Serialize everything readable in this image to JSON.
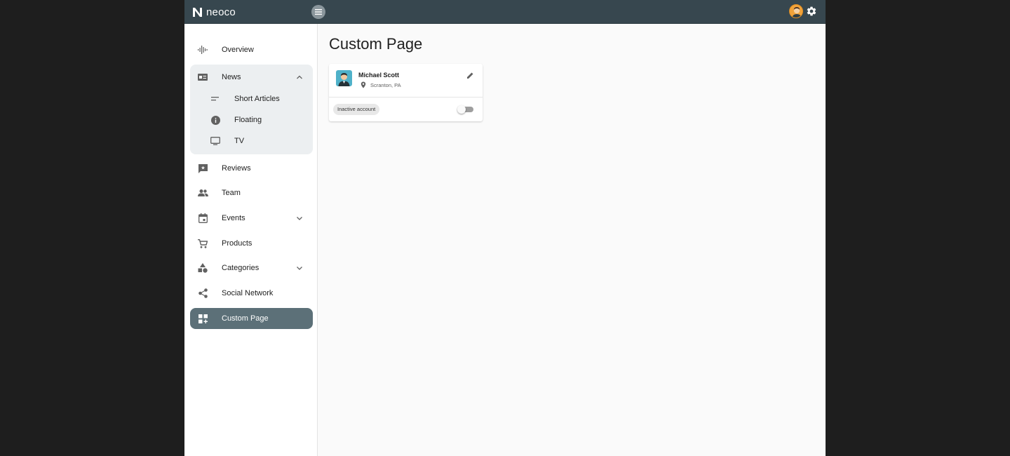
{
  "app": {
    "brand": "neoco"
  },
  "sidebar": {
    "items": [
      {
        "label": "Overview",
        "icon": "waveform-icon"
      },
      {
        "label": "News",
        "icon": "newspaper-icon",
        "expanded": true,
        "children": [
          {
            "label": "Short Articles",
            "icon": "short-text-icon"
          },
          {
            "label": "Floating",
            "icon": "info-icon"
          },
          {
            "label": "TV",
            "icon": "tv-icon"
          }
        ]
      },
      {
        "label": "Reviews",
        "icon": "rate-review-icon"
      },
      {
        "label": "Team",
        "icon": "people-icon"
      },
      {
        "label": "Events",
        "icon": "calendar-icon",
        "expanded": false
      },
      {
        "label": "Products",
        "icon": "cart-icon"
      },
      {
        "label": "Categories",
        "icon": "category-icon",
        "expanded": false
      },
      {
        "label": "Social Network",
        "icon": "share-icon"
      },
      {
        "label": "Custom Page",
        "icon": "dashboard-customize-icon",
        "active": true
      }
    ]
  },
  "main": {
    "title": "Custom Page",
    "card": {
      "name": "Michael Scott",
      "location": "Scranton, PA",
      "status_chip": "Inactive account",
      "toggle_on": false
    }
  },
  "colors": {
    "topbar": "#37474f",
    "active_nav": "#5c7078",
    "group_bg": "#eceff1"
  }
}
